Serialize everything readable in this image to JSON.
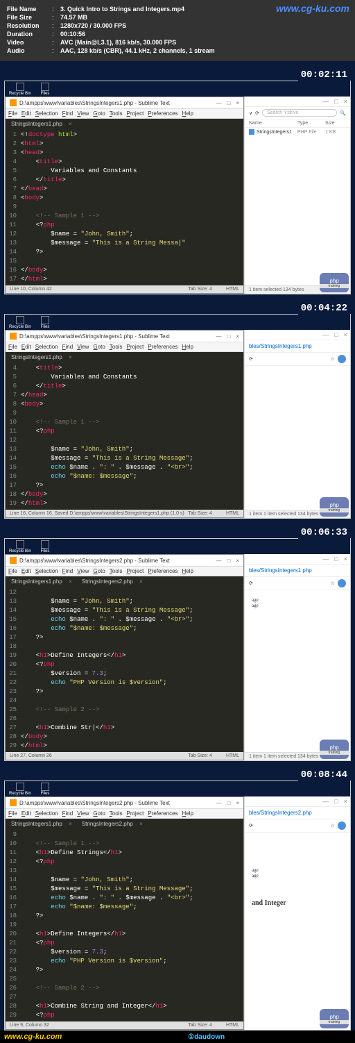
{
  "header": {
    "file_name_label": "File Name",
    "file_name": "3. Quick Intro to Strings and Integers.mp4",
    "file_size_label": "File Size",
    "file_size": "74.57 MB",
    "resolution_label": "Resolution",
    "resolution": "1280x720 / 30.000 FPS",
    "duration_label": "Duration",
    "duration": "00:10:56",
    "video_label": "Video",
    "video": "AVC (Main@L3.1), 816 kb/s, 30.000 FPS",
    "audio_label": "Audio",
    "audio": "AAC, 128 kb/s (CBR), 44.1 kHz, 2 channels, 1 stream",
    "watermark": "www.cg-ku.com"
  },
  "desktop": {
    "recycle": "Recycle Bin",
    "files": "Files"
  },
  "timestamps": {
    "p1": "00:02:11",
    "p2": "00:04:22",
    "p3": "00:06:33",
    "p4": "00:08:44"
  },
  "editor": {
    "title1": "D:\\ampps\\www\\variables\\StringsIntegers1.php - Sublime Text",
    "title2": "D:\\ampps\\www\\variables\\StringsIntegers2.php - Sublime Text",
    "menu": [
      "File",
      "Edit",
      "Selection",
      "Find",
      "View",
      "Goto",
      "Tools",
      "Project",
      "Preferences",
      "Help"
    ],
    "tab1": "StringsIntegers1.php",
    "tab2": "StringsIntegers2.php",
    "status1": "Line 10, Column 42",
    "status2": "Line 16, Column 16. Saved D:\\ampps\\www\\variables\\StringsIntegers1.php (1.0 s)",
    "status3": "Line 27, Column 26",
    "status4": "Line 9, Column 32",
    "tabsize": "Tab Size: 4",
    "lang": "HTML"
  },
  "side": {
    "searchPlaceholder": "Search Y:drive",
    "browserTab1": "bles/StringsIntegers1.php",
    "browserTab2": "bles/StringsIntegers2.php",
    "colName": "Name",
    "colType": "Type",
    "colSize": "Size",
    "fileName": "StringsIntegers1",
    "fileType": "PHP File",
    "fileSize": "1 KB",
    "footer": "1 item selected  134 bytes",
    "footer2": "1 item  1 item selected  134 bytes",
    "age": "age",
    "strAndInt": "and Integer"
  },
  "code1": [
    {
      "n": "1",
      "html": "<span class='t-punc'>&lt;!</span><span class='t-tag'>doctype</span> <span class='t-attr'>html</span><span class='t-punc'>&gt;</span>"
    },
    {
      "n": "2",
      "html": "<span class='t-punc'>&lt;</span><span class='t-tag'>html</span><span class='t-punc'>&gt;</span>"
    },
    {
      "n": "3",
      "html": "<span class='t-punc'>&lt;</span><span class='t-tag'>head</span><span class='t-punc'>&gt;</span>"
    },
    {
      "n": "4",
      "html": "    <span class='t-punc'>&lt;</span><span class='t-tag'>title</span><span class='t-punc'>&gt;</span>"
    },
    {
      "n": "5",
      "html": "        <span class='t-txt'>Variables and Constants</span>"
    },
    {
      "n": "6",
      "html": "    <span class='t-punc'>&lt;/</span><span class='t-tag'>title</span><span class='t-punc'>&gt;</span>"
    },
    {
      "n": "7",
      "html": "<span class='t-punc'>&lt;/</span><span class='t-tag'>head</span><span class='t-punc'>&gt;</span>"
    },
    {
      "n": "8",
      "html": "<span class='t-punc'>&lt;</span><span class='t-tag'>body</span><span class='t-punc'>&gt;</span>"
    },
    {
      "n": "9",
      "html": ""
    },
    {
      "n": "10",
      "html": "    <span class='t-cmt'>&lt;!-- Sample 1 --&gt;</span>"
    },
    {
      "n": "11",
      "html": "    <span class='t-punc'>&lt;?</span><span class='t-tag'>php</span>"
    },
    {
      "n": "12",
      "html": "        <span class='t-var'>$name</span> <span class='t-punc'>=</span> <span class='t-str'>\"John, Smith\"</span><span class='t-punc'>;</span>"
    },
    {
      "n": "13",
      "html": "        <span class='t-var'>$message</span> <span class='t-punc'>=</span> <span class='t-str'>\"This is a String Messa</span><span class='t-txt'>|</span><span class='t-str'>\"</span>"
    },
    {
      "n": "14",
      "html": "    <span class='t-punc'>?&gt;</span>"
    },
    {
      "n": "15",
      "html": ""
    },
    {
      "n": "16",
      "html": "<span class='t-punc'>&lt;/</span><span class='t-tag'>body</span><span class='t-punc'>&gt;</span>"
    },
    {
      "n": "17",
      "html": "<span class='t-punc'>&lt;/</span><span class='t-tag'>html</span><span class='t-punc'>&gt;</span>"
    }
  ],
  "code2": [
    {
      "n": "4",
      "html": "    <span class='t-punc'>&lt;</span><span class='t-tag'>title</span><span class='t-punc'>&gt;</span>"
    },
    {
      "n": "5",
      "html": "        <span class='t-txt'>Variables and Constants</span>"
    },
    {
      "n": "6",
      "html": "    <span class='t-punc'>&lt;/</span><span class='t-tag'>title</span><span class='t-punc'>&gt;</span>"
    },
    {
      "n": "7",
      "html": "<span class='t-punc'>&lt;/</span><span class='t-tag'>head</span><span class='t-punc'>&gt;</span>"
    },
    {
      "n": "8",
      "html": "<span class='t-punc'>&lt;</span><span class='t-tag'>body</span><span class='t-punc'>&gt;</span>"
    },
    {
      "n": "9",
      "html": ""
    },
    {
      "n": "10",
      "html": "    <span class='t-cmt'>&lt;!-- Sample 1 --&gt;</span>"
    },
    {
      "n": "11",
      "html": "    <span class='t-punc'>&lt;?</span><span class='t-tag'>php</span>"
    },
    {
      "n": "12",
      "html": ""
    },
    {
      "n": "13",
      "html": "        <span class='t-var'>$name</span> <span class='t-punc'>=</span> <span class='t-str'>\"John, Smith\"</span><span class='t-punc'>;</span>"
    },
    {
      "n": "14",
      "html": "        <span class='t-var'>$message</span> <span class='t-punc'>=</span> <span class='t-str'>\"This is a String Message\"</span><span class='t-punc'>;</span>"
    },
    {
      "n": "15",
      "html": "        <span class='t-kw'>echo</span> <span class='t-var'>$name</span> <span class='t-punc'>.</span> <span class='t-str'>\": \"</span> <span class='t-punc'>.</span> <span class='t-var'>$message</span> <span class='t-punc'>.</span> <span class='t-str'>\"&lt;br&gt;\"</span><span class='t-punc'>;</span>"
    },
    {
      "n": "16",
      "html": "        <span class='t-kw'>echo</span> <span class='t-str'>\"$name: $message\"</span><span class='t-punc'>;</span>"
    },
    {
      "n": "17",
      "html": "    <span class='t-punc'>?&gt;</span>"
    },
    {
      "n": "18",
      "html": "<span class='t-punc'>&lt;/</span><span class='t-tag'>body</span><span class='t-punc'>&gt;</span>"
    },
    {
      "n": "19",
      "html": "<span class='t-punc'>&lt;/</span><span class='t-tag'>html</span><span class='t-punc'>&gt;</span>"
    }
  ],
  "code3": [
    {
      "n": "12",
      "html": ""
    },
    {
      "n": "13",
      "html": "        <span class='t-var'>$name</span> <span class='t-punc'>=</span> <span class='t-str'>\"John, Smith\"</span><span class='t-punc'>;</span>"
    },
    {
      "n": "14",
      "html": "        <span class='t-var'>$message</span> <span class='t-punc'>=</span> <span class='t-str'>\"This is a String Message\"</span><span class='t-punc'>;</span>"
    },
    {
      "n": "15",
      "html": "        <span class='t-kw'>echo</span> <span class='t-var'>$name</span> <span class='t-punc'>.</span> <span class='t-str'>\": \"</span> <span class='t-punc'>.</span> <span class='t-var'>$message</span> <span class='t-punc'>.</span> <span class='t-str'>\"&lt;br&gt;\"</span><span class='t-punc'>;</span>"
    },
    {
      "n": "16",
      "html": "        <span class='t-kw'>echo</span> <span class='t-str'>\"$name: $message\"</span><span class='t-punc'>;</span>"
    },
    {
      "n": "17",
      "html": "    <span class='t-punc'>?&gt;</span>"
    },
    {
      "n": "18",
      "html": ""
    },
    {
      "n": "19",
      "html": "    <span class='t-punc'>&lt;</span><span class='t-tag'>h1</span><span class='t-punc'>&gt;</span><span class='t-txt'>Define Integers</span><span class='t-punc'>&lt;/</span><span class='t-tag'>h1</span><span class='t-punc'>&gt;</span>"
    },
    {
      "n": "20",
      "html": "    <span class='t-punc'>&lt;?</span><span class='t-tag'>php</span>"
    },
    {
      "n": "21",
      "html": "        <span class='t-var'>$version</span> <span class='t-punc'>=</span> <span class='t-num'>7.3</span><span class='t-punc'>;</span>"
    },
    {
      "n": "22",
      "html": "        <span class='t-kw'>echo</span> <span class='t-str'>\"PHP Version is $version\"</span><span class='t-punc'>;</span>"
    },
    {
      "n": "23",
      "html": "    <span class='t-punc'>?&gt;</span>"
    },
    {
      "n": "24",
      "html": ""
    },
    {
      "n": "25",
      "html": "    <span class='t-cmt'>&lt;!-- Sample 2 --&gt;</span>"
    },
    {
      "n": "26",
      "html": ""
    },
    {
      "n": "27",
      "html": "    <span class='t-punc'>&lt;</span><span class='t-tag'>h1</span><span class='t-punc'>&gt;</span><span class='t-txt'>Combine Str</span><span class='t-txt'>|</span><span class='t-punc'>&lt;/</span><span class='t-tag'>h1</span><span class='t-punc'>&gt;</span>"
    },
    {
      "n": "28",
      "html": "<span class='t-punc'>&lt;/</span><span class='t-tag'>body</span><span class='t-punc'>&gt;</span>"
    },
    {
      "n": "29",
      "html": "<span class='t-punc'>&lt;/</span><span class='t-tag'>html</span><span class='t-punc'>&gt;</span>"
    }
  ],
  "code4": [
    {
      "n": "9",
      "html": ""
    },
    {
      "n": "10",
      "html": "    <span class='t-cmt'>&lt;!-- Sample 1 --&gt;</span>"
    },
    {
      "n": "11",
      "html": "    <span class='t-punc'>&lt;</span><span class='t-tag'>h1</span><span class='t-punc'>&gt;</span><span class='t-txt'>Define Strings</span><span class='t-punc'>&lt;/</span><span class='t-tag'>h1</span><span class='t-punc'>&gt;</span>"
    },
    {
      "n": "12",
      "html": "    <span class='t-punc'>&lt;?</span><span class='t-tag'>php</span>"
    },
    {
      "n": "13",
      "html": ""
    },
    {
      "n": "14",
      "html": "        <span class='t-var'>$name</span> <span class='t-punc'>=</span> <span class='t-str'>\"John, Smith\"</span><span class='t-punc'>;</span>"
    },
    {
      "n": "15",
      "html": "        <span class='t-var'>$message</span> <span class='t-punc'>=</span> <span class='t-str'>\"This is a String Message\"</span><span class='t-punc'>;</span>"
    },
    {
      "n": "16",
      "html": "        <span class='t-kw'>echo</span> <span class='t-var'>$name</span> <span class='t-punc'>.</span> <span class='t-str'>\": \"</span> <span class='t-punc'>.</span> <span class='t-var'>$message</span> <span class='t-punc'>.</span> <span class='t-str'>\"&lt;br&gt;\"</span><span class='t-punc'>;</span>"
    },
    {
      "n": "17",
      "html": "        <span class='t-kw'>echo</span> <span class='t-str'>\"$name: $message\"</span><span class='t-punc'>;</span>"
    },
    {
      "n": "18",
      "html": "    <span class='t-punc'>?&gt;</span>"
    },
    {
      "n": "19",
      "html": ""
    },
    {
      "n": "20",
      "html": "    <span class='t-punc'>&lt;</span><span class='t-tag'>h1</span><span class='t-punc'>&gt;</span><span class='t-txt'>Define Integers</span><span class='t-punc'>&lt;/</span><span class='t-tag'>h1</span><span class='t-punc'>&gt;</span>"
    },
    {
      "n": "21",
      "html": "    <span class='t-punc'>&lt;?</span><span class='t-tag'>php</span>"
    },
    {
      "n": "22",
      "html": "        <span class='t-var'>$version</span> <span class='t-punc'>=</span> <span class='t-num'>7.3</span><span class='t-punc'>;</span>"
    },
    {
      "n": "23",
      "html": "        <span class='t-kw'>echo</span> <span class='t-str'>\"PHP Version is $version\"</span><span class='t-punc'>;</span>"
    },
    {
      "n": "24",
      "html": "    <span class='t-punc'>?&gt;</span>"
    },
    {
      "n": "25",
      "html": ""
    },
    {
      "n": "26",
      "html": "    <span class='t-cmt'>&lt;!-- Sample 2 --&gt;</span>"
    },
    {
      "n": "27",
      "html": ""
    },
    {
      "n": "28",
      "html": "    <span class='t-punc'>&lt;</span><span class='t-tag'>h1</span><span class='t-punc'>&gt;</span><span class='t-txt'>Combine String and Integer</span><span class='t-punc'>&lt;/</span><span class='t-tag'>h1</span><span class='t-punc'>&gt;</span>"
    },
    {
      "n": "29",
      "html": "    <span class='t-punc'>&lt;?</span><span class='t-tag'>php</span>"
    }
  ],
  "badge": {
    "php": "php",
    "training": "training"
  },
  "bottom": {
    "left": "www.cg-ku.com",
    "mid": "①daudown"
  }
}
